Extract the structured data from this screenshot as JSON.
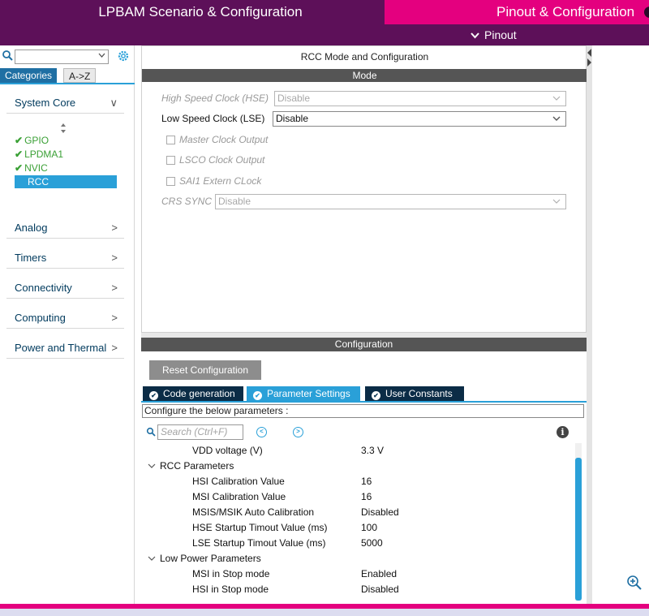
{
  "header": {
    "tab_lpbam": "LPBAM Scenario & Configuration",
    "tab_pinout": "Pinout & Configuration",
    "sub_pinout": "Pinout"
  },
  "sidebar": {
    "search_value": "",
    "tabs": [
      "Categories",
      "A->Z"
    ],
    "categories": [
      {
        "label": "System Core",
        "chevron": "∨"
      },
      {
        "label": "Analog",
        "chevron": ">"
      },
      {
        "label": "Timers",
        "chevron": ">"
      },
      {
        "label": "Connectivity",
        "chevron": ">"
      },
      {
        "label": "Computing",
        "chevron": ">"
      },
      {
        "label": "Power and Thermal",
        "chevron": ">"
      }
    ],
    "peripherals": [
      {
        "label": "GPIO",
        "checked": true
      },
      {
        "label": "LPDMA1",
        "checked": true
      },
      {
        "label": "NVIC",
        "checked": true
      },
      {
        "label": "RCC",
        "checked": false,
        "selected": true
      }
    ]
  },
  "mode": {
    "title": "RCC Mode and Configuration",
    "header": "Mode",
    "hse_label": "High Speed Clock (HSE)",
    "hse_value": "Disable",
    "lse_label": "Low Speed Clock (LSE)",
    "lse_value": "Disable",
    "mco_label": "Master Clock Output",
    "lsco_label": "LSCO Clock Output",
    "sai1_label": "SAI1 Extern CLock",
    "crs_label": "CRS SYNC",
    "crs_value": "Disable"
  },
  "config": {
    "header": "Configuration",
    "reset_label": "Reset Configuration",
    "tabs": [
      "Code generation",
      "Parameter Settings",
      "User Constants"
    ],
    "note": "Configure the below parameters :",
    "search_placeholder": "Search (Ctrl+F)",
    "rows": [
      {
        "kind": "param",
        "name": "VDD voltage (V)",
        "value": "3.3 V"
      },
      {
        "kind": "group",
        "name": "RCC Parameters"
      },
      {
        "kind": "param",
        "name": "HSI Calibration Value",
        "value": "16"
      },
      {
        "kind": "param",
        "name": "MSI Calibration Value",
        "value": "16"
      },
      {
        "kind": "param",
        "name": "MSIS/MSIK Auto Calibration",
        "value": "Disabled"
      },
      {
        "kind": "param",
        "name": "HSE Startup Timout Value (ms)",
        "value": "100"
      },
      {
        "kind": "param",
        "name": "LSE Startup Timout Value (ms)",
        "value": "5000"
      },
      {
        "kind": "group",
        "name": "Low Power Parameters"
      },
      {
        "kind": "param",
        "name": "MSI in Stop mode",
        "value": "Enabled"
      },
      {
        "kind": "param",
        "name": "HSI in Stop mode",
        "value": "Disabled"
      }
    ]
  },
  "colors": {
    "topbar": "#5d1059",
    "accent_pink": "#e4007f",
    "accent_blue": "#2aa0d8",
    "check_green": "#3aa035"
  }
}
